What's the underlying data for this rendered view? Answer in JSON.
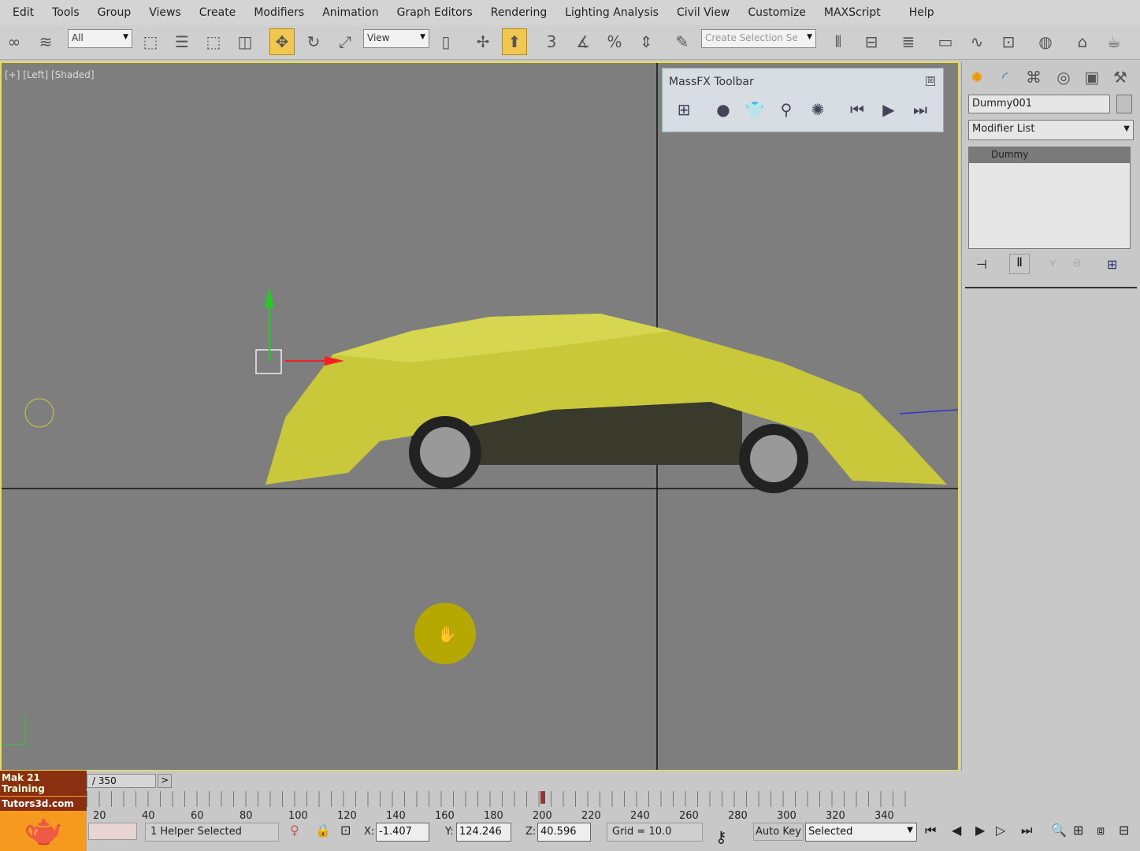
{
  "menu": [
    "Edit",
    "Tools",
    "Group",
    "Views",
    "Create",
    "Modifiers",
    "Animation",
    "Graph Editors",
    "Rendering",
    "Lighting Analysis",
    "Civil View",
    "Customize",
    "MAXScript",
    "Help"
  ],
  "toolbar": {
    "selection_filter": "All",
    "reference_coord": "View",
    "snap_label": "3",
    "named_selection_placeholder": "Create Selection Se"
  },
  "viewport": {
    "label": "[+] [Left] [Shaded]",
    "cloth_color": "#c8c83a",
    "border_color": "#e6df45"
  },
  "massfx": {
    "title": "MassFX Toolbar",
    "close": "☒"
  },
  "command_panel": {
    "object_name": "Dummy001",
    "modifier_list": "Modifier List",
    "stack": [
      "Dummy"
    ]
  },
  "timeline": {
    "frame_range": "/ 350",
    "next": ">",
    "ticks": [
      "20",
      "40",
      "60",
      "80",
      "100",
      "120",
      "140",
      "160",
      "180",
      "200",
      "220",
      "240",
      "260",
      "280",
      "300",
      "320",
      "340"
    ],
    "current_frame_fraction": 0.57
  },
  "status": {
    "selection": "1 Helper Selected",
    "x_label": "X:",
    "x": "-1.407",
    "y_label": "Y:",
    "y": "124.246",
    "z_label": "Z:",
    "z": "40.596",
    "grid": "Grid = 10.0",
    "auto_key": "Auto Key",
    "key_mode": "Selected"
  },
  "logo": {
    "line1": "Mak 21 Training",
    "line2": "Tutors3d.com"
  }
}
